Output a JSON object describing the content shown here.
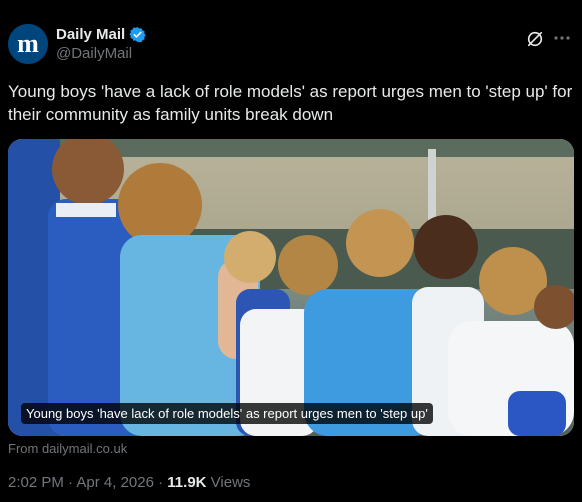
{
  "author": {
    "display_name": "Daily Mail",
    "handle": "@DailyMail",
    "avatar_letter": "m",
    "verified": true
  },
  "tweet": {
    "text": "Young boys 'have a lack of role models' as report urges men to 'step up' for their community as family units break down"
  },
  "card": {
    "caption": "Young boys 'have lack of role models' as report urges men to 'step up'",
    "source": "From dailymail.co.uk"
  },
  "meta": {
    "time": "2:02 PM",
    "separator1": " · ",
    "date": "Apr 4, 2026",
    "separator2": " · ",
    "views_count": "11.9K",
    "views_label": " Views"
  },
  "colors": {
    "background": "#000000",
    "text": "#e7e9ea",
    "secondary": "#71767b",
    "verified_blue": "#1d9bf0",
    "avatar_bg": "#00457c"
  },
  "icons": {
    "verified": "verified-badge-icon",
    "grok": "grok-icon",
    "more": "more-options-icon"
  }
}
